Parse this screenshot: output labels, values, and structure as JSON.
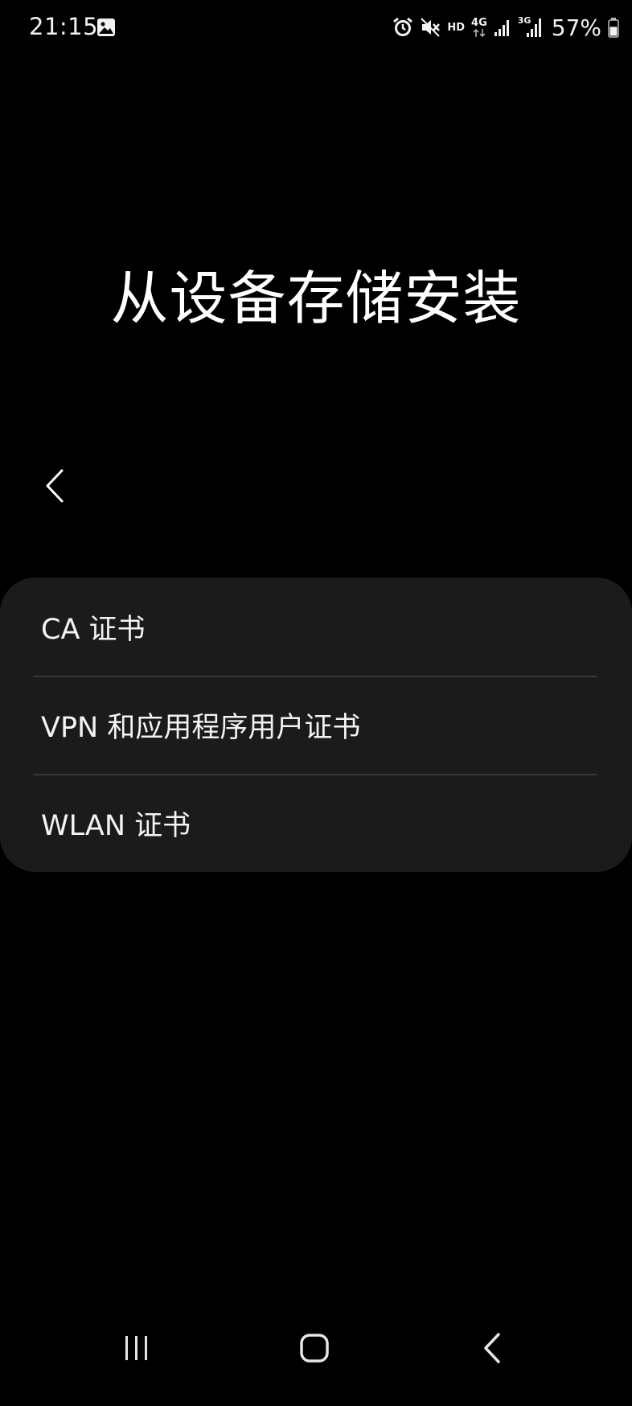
{
  "status_bar": {
    "time": "21:15",
    "left_icon": "image-notification-icon",
    "right_icons": [
      "alarm-icon",
      "mute-icon",
      "hd-voice-icon",
      "4g-data-icon",
      "signal-icon",
      "3g-signal-icon"
    ],
    "hd_label": "HD",
    "net_4g_label": "4G",
    "net_3g_label": "3G",
    "battery_percent": "57%",
    "battery_level": 0.57
  },
  "page": {
    "title": "从设备存储安装"
  },
  "back": {
    "icon": "chevron-left-icon"
  },
  "list": {
    "items": [
      {
        "label": "CA 证书"
      },
      {
        "label": "VPN 和应用程序用户证书"
      },
      {
        "label": "WLAN 证书"
      }
    ]
  },
  "nav_bar": {
    "recents_icon": "recents-icon",
    "home_icon": "home-icon",
    "back_icon": "back-icon"
  },
  "colors": {
    "background": "#000000",
    "card": "#1b1b1b",
    "divider": "#3a3a3a",
    "text": "#ffffff"
  }
}
